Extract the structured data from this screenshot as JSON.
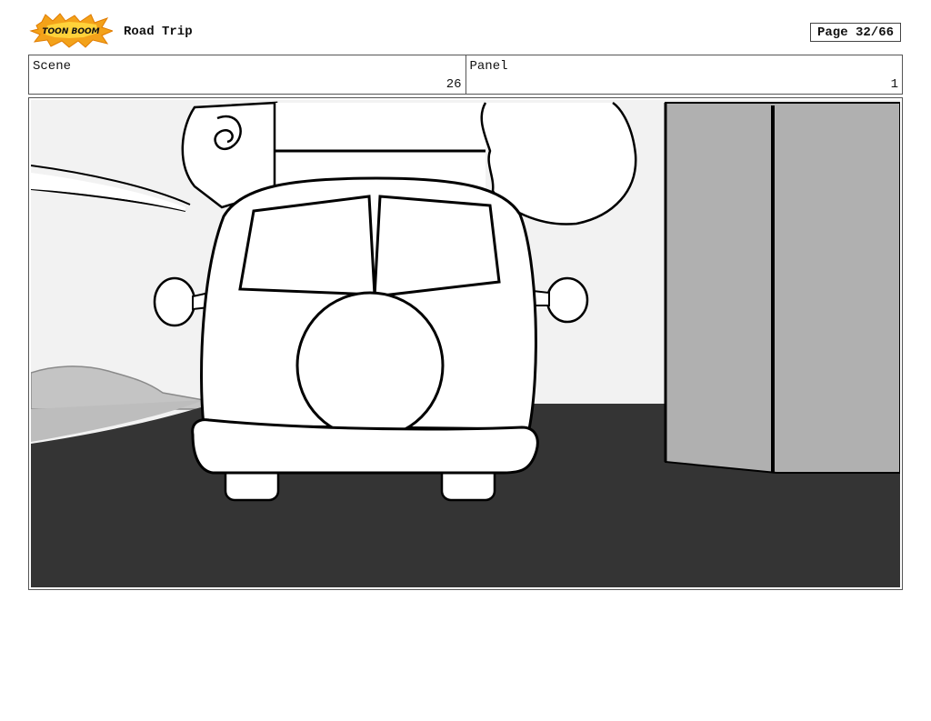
{
  "header": {
    "logo_text": "TOON BOOM",
    "project_title": "Road Trip",
    "page_label": "Page 32/66"
  },
  "info": {
    "scene_label": "Scene",
    "scene_value": "26",
    "panel_label": "Panel",
    "panel_value": "1"
  },
  "panel_image": {
    "subject": "storyboard-sketch-van",
    "colors": {
      "sky": "#f2f2f2",
      "road": "#343434",
      "hill": "#c4c4c4",
      "building": "#b0b0b0",
      "line": "#000000"
    }
  }
}
